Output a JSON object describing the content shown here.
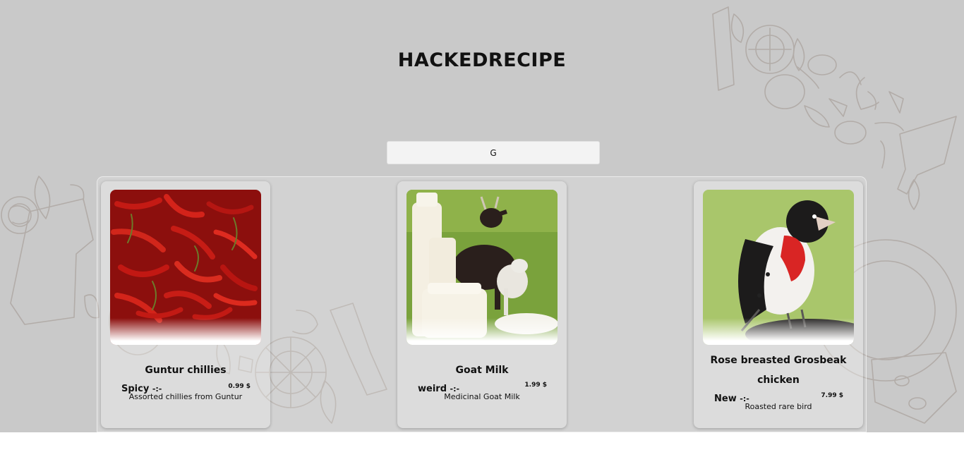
{
  "app": {
    "title": "HACKEDRECIPE"
  },
  "search": {
    "value": "G",
    "placeholder": ""
  },
  "products": [
    {
      "name": "Guntur chillies",
      "category": "Spicy",
      "separator": "-:-",
      "price": "0.99 $",
      "description": "Assorted chillies from Guntur",
      "image": "red-chillies-photo"
    },
    {
      "name": "Goat Milk",
      "category": "weird",
      "separator": "-:-",
      "price": "1.99 $",
      "description": "Medicinal Goat Milk",
      "image": "goat-and-milk-photo"
    },
    {
      "name": "Rose breasted Grosbeak chicken",
      "category": "New",
      "separator": "-:-",
      "price": "7.99 $",
      "description": "Roasted rare bird",
      "image": "grosbeak-bird-photo"
    }
  ],
  "colors": {
    "background": "#c9c9c9",
    "doodle": "#b3aeaa",
    "card": "#ffffff",
    "text": "#111111"
  }
}
